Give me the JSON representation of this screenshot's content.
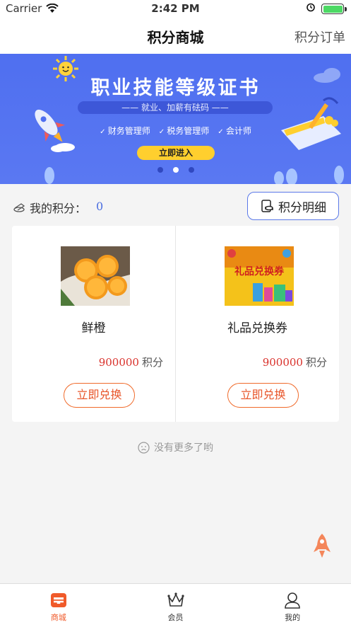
{
  "status_bar": {
    "carrier": "Carrier",
    "time": "2:42 PM"
  },
  "nav": {
    "title": "积分商城",
    "right_label": "积分订单"
  },
  "banner": {
    "headline": "职业技能等级证书",
    "subline": "—— 就业、加薪有砝码 ——",
    "tags": [
      "财务管理师",
      "税务管理师",
      "会计师"
    ],
    "cta": "立即进入",
    "carousel_active_index": 1,
    "carousel_count": 3
  },
  "points": {
    "label": "我的积分：",
    "value": "0",
    "detail_button": "积分明细"
  },
  "products": [
    {
      "name": "鲜橙",
      "price": "900000",
      "unit": "积分",
      "button": "立即兑换",
      "image_icon": "orange-photo"
    },
    {
      "name": "礼品兑换券",
      "price": "900000",
      "unit": "积分",
      "button": "立即兑换",
      "image_icon": "gift-voucher-image",
      "image_text": "礼品兑换券"
    }
  ],
  "footer_note": "没有更多了哟",
  "tabs": [
    {
      "label": "商城",
      "icon": "shop-icon",
      "active": true
    },
    {
      "label": "会员",
      "icon": "crown-icon",
      "active": false
    },
    {
      "label": "我的",
      "icon": "user-icon",
      "active": false
    }
  ],
  "colors": {
    "accent": "#f05a2a",
    "banner_bg": "#4f6ff0",
    "price": "#d9302a",
    "points_value": "#4a6ee0"
  }
}
